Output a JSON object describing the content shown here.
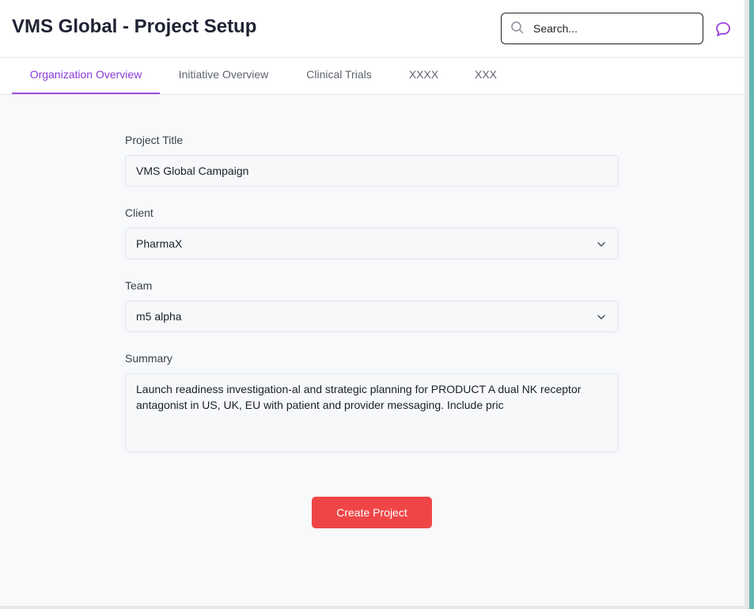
{
  "header": {
    "title": "VMS Global - Project Setup",
    "search_placeholder": "Search..."
  },
  "tabs": [
    {
      "label": "Organization Overview",
      "active": true
    },
    {
      "label": "Initiative Overview",
      "active": false
    },
    {
      "label": "Clinical Trials",
      "active": false
    },
    {
      "label": "XXXX",
      "active": false
    },
    {
      "label": "XXX",
      "active": false
    }
  ],
  "form": {
    "project_title": {
      "label": "Project Title",
      "value": "VMS Global Campaign"
    },
    "client": {
      "label": "Client",
      "value": "PharmaX"
    },
    "team": {
      "label": "Team",
      "value": "m5 alpha"
    },
    "summary": {
      "label": "Summary",
      "value": "Launch readiness investigation-al and strategic planning for PRODUCT A dual NK receptor antagonist in US, UK, EU with patient and provider messaging. Include pric"
    },
    "submit_label": "Create Project"
  },
  "colors": {
    "accent": "#8a3ad8",
    "button": "#ef4546",
    "chat_icon": "#9b3fe0"
  },
  "icons": {
    "search": "search-icon",
    "chat": "chat-bubble-icon",
    "chevron": "chevron-down-icon"
  }
}
